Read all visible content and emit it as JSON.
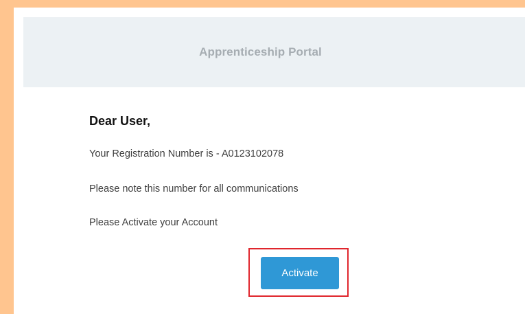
{
  "header": {
    "title": "Apprenticeship Portal"
  },
  "message": {
    "greeting": "Dear User,",
    "registration_line": "Your Registration Number is - A0123102078",
    "note_line": "Please note this number for all communications",
    "activate_line": "Please Activate your Account"
  },
  "actions": {
    "activate_label": "Activate"
  },
  "colors": {
    "page_background": "#ffc58f",
    "header_background": "#ecf1f4",
    "button_background": "#2f98d6",
    "highlight_border": "#e0262d"
  }
}
